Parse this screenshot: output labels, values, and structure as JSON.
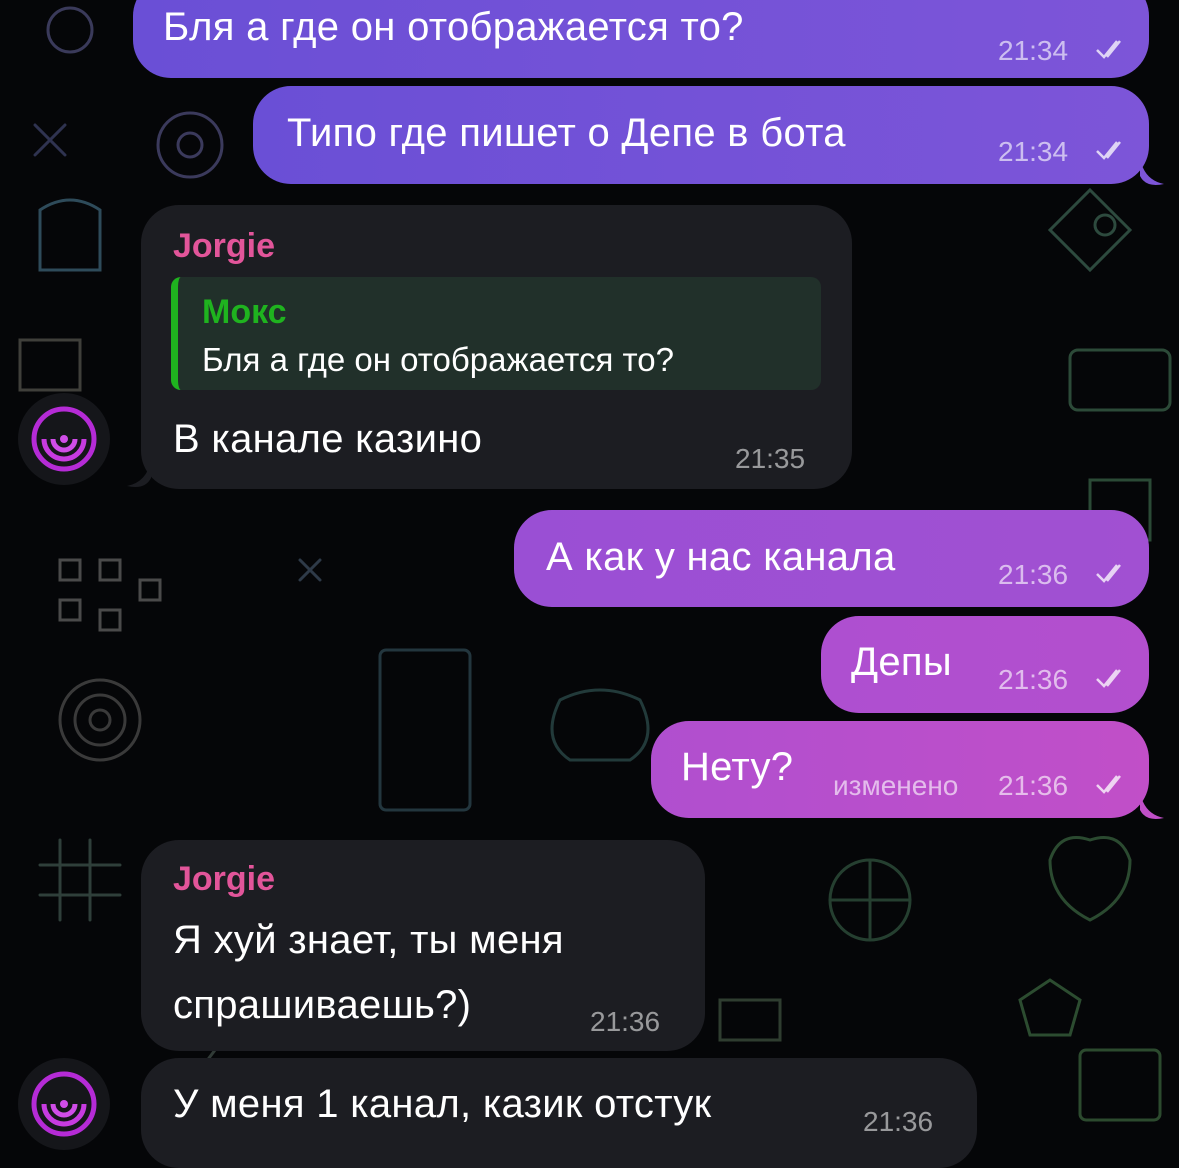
{
  "messages": [
    {
      "id": "m1",
      "direction": "out",
      "text": "Бля а где он отображается то?",
      "time": "21:34",
      "read": true
    },
    {
      "id": "m2",
      "direction": "out",
      "text": "Типо где пишет о Депе в бота",
      "time": "21:34",
      "read": true
    },
    {
      "id": "m3",
      "direction": "in",
      "sender": "Jorgie",
      "reply": {
        "name": "Мокс",
        "text": "Бля а где он отображается то?"
      },
      "text": "В канале казино",
      "time": "21:35"
    },
    {
      "id": "m4",
      "direction": "out",
      "text": "А как у нас канала",
      "time": "21:36",
      "read": true
    },
    {
      "id": "m5",
      "direction": "out",
      "text": "Депы",
      "time": "21:36",
      "read": true
    },
    {
      "id": "m6",
      "direction": "out",
      "text": "Нету?",
      "edited": "изменено",
      "time": "21:36",
      "read": true
    },
    {
      "id": "m7",
      "direction": "in",
      "sender": "Jorgie",
      "text_line1": "Я хуй знает, ты меня",
      "text_line2": "спрашиваешь?)",
      "time": "21:36"
    },
    {
      "id": "m8",
      "direction": "in",
      "text": "У меня 1 канал, казик отстук",
      "time": "21:36"
    }
  ],
  "colors": {
    "outgoing_start": "#6a4fd6",
    "outgoing_end": "#c14fc8",
    "incoming": "#1c1d22",
    "sender_name": "#e2559a",
    "reply_accent": "#1fb31f",
    "background": "#050608"
  },
  "icons": {
    "avatar": "radar-logo-icon",
    "read_status": "double-check-icon"
  }
}
